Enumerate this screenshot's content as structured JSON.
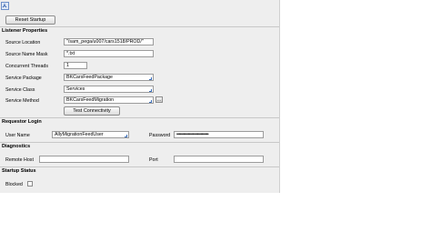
{
  "toolbar": {
    "reset_label": "Reset Startup"
  },
  "listener": {
    "header": "Listener Properties",
    "source_location": {
      "label": "Source Location",
      "value": "\"/sam_pega/u007/cars1518/PROD/\""
    },
    "source_name_mask": {
      "label": "Source Name Mask",
      "value": "*.txt"
    },
    "concurrent_threads": {
      "label": "Concurrent Threads",
      "value": "1"
    },
    "service_package": {
      "label": "Service Package",
      "value": "BKCarsFeedPackage"
    },
    "service_class": {
      "label": "Service Class",
      "value": "Services"
    },
    "service_method": {
      "label": "Service Method",
      "value": "BKCarsFeedMigration"
    },
    "test_label": "Test Connectivity"
  },
  "requestor": {
    "header": "Requestor Login",
    "user_name": {
      "label": "User Name",
      "value": "AllyMigrationFeedUser"
    },
    "password": {
      "label": "Password",
      "value": "••••••••••••••••••••••••••••"
    }
  },
  "diagnostics": {
    "header": "Diagnostics",
    "remote_host": {
      "label": "Remote Host",
      "value": ""
    },
    "port": {
      "label": "Port",
      "value": ""
    }
  },
  "startup": {
    "header": "Startup Status",
    "blocked": {
      "label": "Blocked",
      "checked": false
    }
  }
}
